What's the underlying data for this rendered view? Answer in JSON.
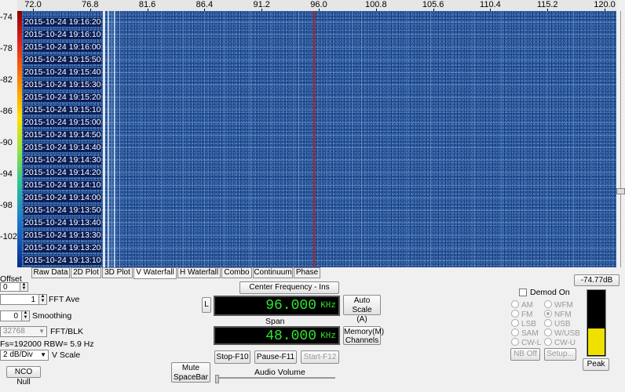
{
  "frequency_axis": {
    "ticks": [
      "72.0",
      "76.8",
      "81.6",
      "86.4",
      "91.2",
      "96.0",
      "100.8",
      "105.6",
      "110.4",
      "115.2",
      "120.0"
    ]
  },
  "db_axis": {
    "ticks": [
      "-74",
      "-78",
      "-82",
      "-86",
      "-90",
      "-94",
      "-98",
      "-102"
    ]
  },
  "waterfall": {
    "timestamps": [
      "2015-10-24 19:16:20",
      "2015-10-24 19:16:10",
      "2015-10-24 19:16:00",
      "2015-10-24 19:15:50",
      "2015-10-24 19:15:40",
      "2015-10-24 19:15:30",
      "2015-10-24 19:15:20",
      "2015-10-24 19:15:10",
      "2015-10-24 19:15:00",
      "2015-10-24 19:14:50",
      "2015-10-24 19:14:40",
      "2015-10-24 19:14:30",
      "2015-10-24 19:14:20",
      "2015-10-24 19:14:10",
      "2015-10-24 19:14:00",
      "2015-10-24 19:13:50",
      "2015-10-24 19:13:40",
      "2015-10-24 19:13:30",
      "2015-10-24 19:13:20",
      "2015-10-24 19:13:10"
    ],
    "background_color": "#22559b",
    "center_marker_color": "#b22222"
  },
  "tabs": [
    "Raw Data",
    "2D Plot",
    "3D Plot",
    "V Waterfall",
    "H Waterfall",
    "Combo",
    "Continuum",
    "Phase"
  ],
  "active_tab": "V Waterfall",
  "left_panel": {
    "offset_label": "Offset",
    "offset_value": "0",
    "fft_ave_value": "1",
    "fft_ave_label": "FFT Ave",
    "smoothing_value": "0",
    "smoothing_label": "Smoothing",
    "fft_blk_value": "32768",
    "fft_blk_label": "FFT/BLK",
    "fs_text": "Fs=192000 RBW= 5.9 Hz",
    "vscale_value": "2 dB/Div",
    "vscale_label": "V Scale",
    "nco_null_label": "NCO Null"
  },
  "center_panel": {
    "center_freq_button": "Center Frequency - Ins",
    "l_button": "L",
    "center_value": "96.000",
    "center_unit": "KHz",
    "auto_scale_line1": "Auto Scale",
    "auto_scale_line2": "(A)",
    "span_label": "Span",
    "span_value": "48.000",
    "span_unit": "KHz",
    "memory_line1": "Memory(M)",
    "memory_line2": "Channels",
    "stop_label": "Stop-F10",
    "pause_label": "Pause-F11",
    "start_label": "Start-F12",
    "mute_line1": "Mute",
    "mute_line2": "SpaceBar",
    "audio_volume_label": "Audio Volume"
  },
  "right_panel": {
    "demod_on_label": "Demod On",
    "level_readout": "-74.77dB",
    "modes_left": [
      "AM",
      "FM",
      "LSB",
      "SAM",
      "CW-L"
    ],
    "modes_right": [
      "WFM",
      "NFM",
      "USB",
      "W/USB",
      "CW-U"
    ],
    "selected_mode": "NFM",
    "nb_off_label": "NB Off",
    "setup_label": "Setup...",
    "peak_label": "Peak",
    "meter_level_fraction": 0.42
  },
  "colors": {
    "lcd_text": "#2ee62e",
    "meter_fill": "#f0e000"
  }
}
